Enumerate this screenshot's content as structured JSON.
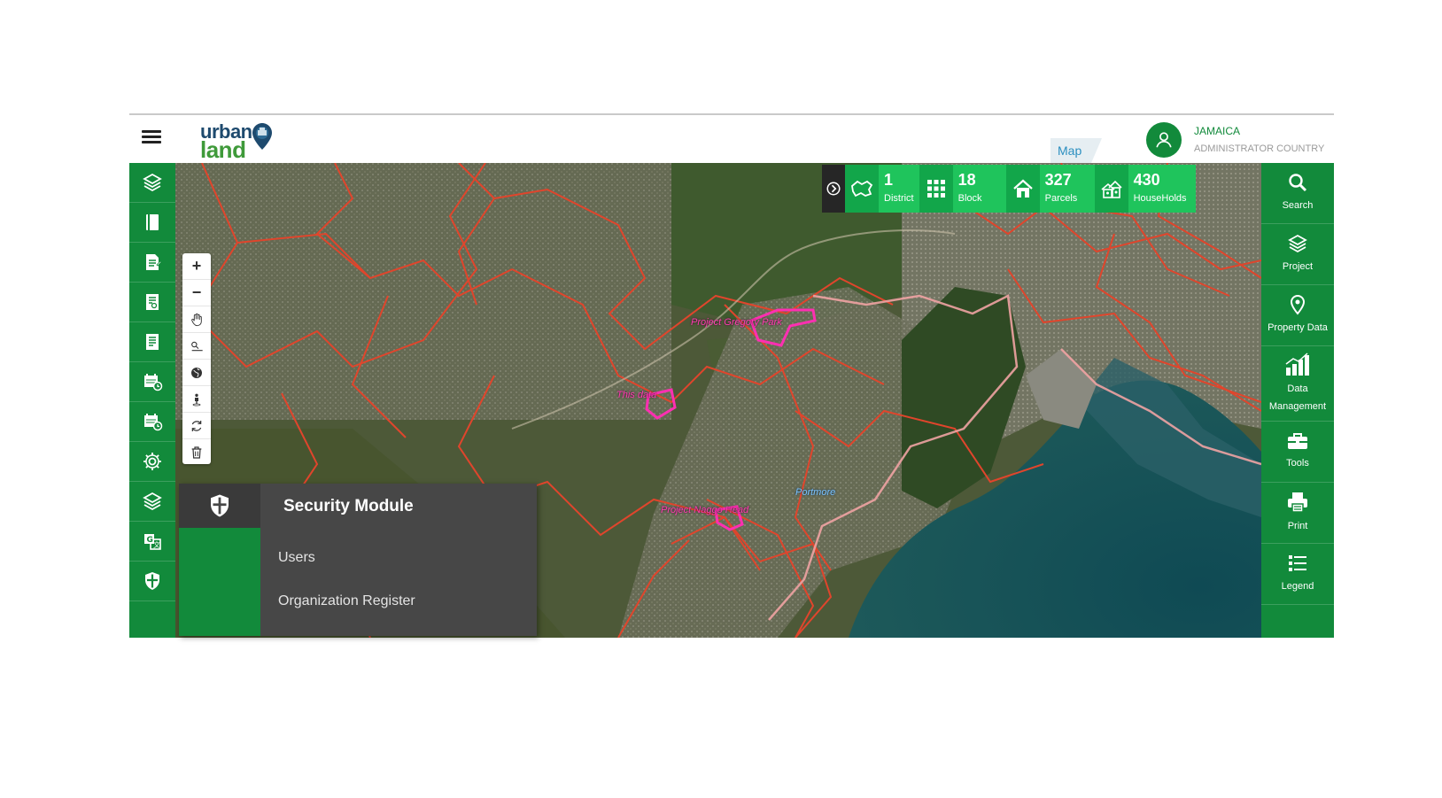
{
  "header": {
    "logo_top": "urban",
    "logo_bottom": "land",
    "map_tab": "Map",
    "user": {
      "country": "JAMAICA",
      "role": "ADMINISTRATOR COUNTRY"
    }
  },
  "left_sidebar": {
    "icons": [
      "layers-icon",
      "book-icon",
      "form-icon",
      "document-search-icon",
      "document-list-icon",
      "calendar-clock-icon",
      "calendar-clock-icon",
      "gear-icon",
      "layers-icon",
      "translate-icon",
      "shield-icon"
    ]
  },
  "map_controls": [
    "zoom-in-icon",
    "zoom-out-icon",
    "pan-hand-icon",
    "measure-icon",
    "globe-icon",
    "street-view-icon",
    "refresh-icon",
    "trash-icon"
  ],
  "stats": [
    {
      "value": "1",
      "label": "District",
      "icon": "map-outline-icon"
    },
    {
      "value": "18",
      "label": "Block",
      "icon": "grid-icon"
    },
    {
      "value": "327",
      "label": "Parcels",
      "icon": "house-icon"
    },
    {
      "value": "430",
      "label": "HouseHolds",
      "icon": "households-icon"
    }
  ],
  "map_labels": {
    "gregory": "Project Gregory Park",
    "thisdata": "This data",
    "portmore": "Portmore",
    "naggo": "Project Naggo Head"
  },
  "right_sidebar": [
    {
      "label": "Search",
      "icon": "search-icon"
    },
    {
      "label": "Project",
      "icon": "layers-icon"
    },
    {
      "label": "Property Data",
      "icon": "map-pin-icon"
    },
    {
      "label": "Data Management",
      "icon": "bar-chart-icon"
    },
    {
      "label": "Tools",
      "icon": "toolbox-icon"
    },
    {
      "label": "Print",
      "icon": "printer-icon"
    },
    {
      "label": "Legend",
      "icon": "list-icon"
    }
  ],
  "security_menu": {
    "title": "Security Module",
    "items": [
      "Users",
      "Organization Register"
    ]
  },
  "colors": {
    "brand_green": "#128a3b",
    "stat_green": "#1fc45c",
    "boundary_red": "#e0452c",
    "project_magenta": "#ff3db0"
  }
}
